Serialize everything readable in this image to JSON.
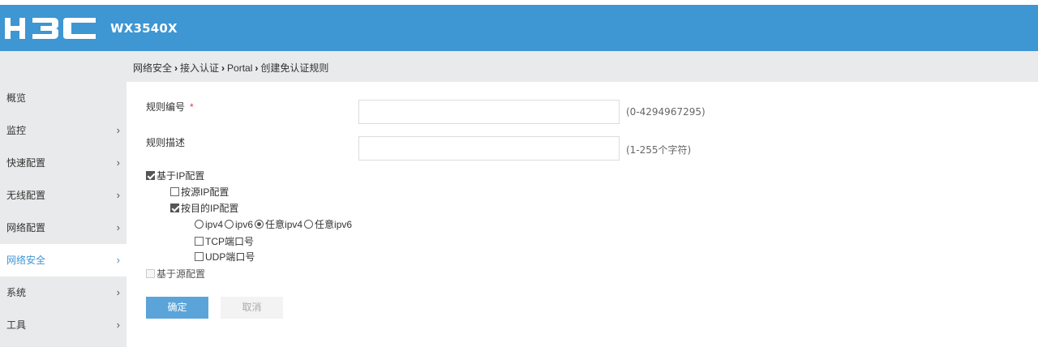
{
  "header": {
    "model": "WX3540X",
    "logo_text": "H3C"
  },
  "breadcrumb": [
    "网络安全",
    "接入认证",
    "Portal",
    "创建免认证规则"
  ],
  "sidebar": {
    "items": [
      {
        "label": "概览",
        "chevron": ""
      },
      {
        "label": "监控",
        "chevron": "›"
      },
      {
        "label": "快速配置",
        "chevron": "›"
      },
      {
        "label": "无线配置",
        "chevron": "›"
      },
      {
        "label": "网络配置",
        "chevron": "›"
      },
      {
        "label": "网络安全",
        "chevron": "›"
      },
      {
        "label": "系统",
        "chevron": "›"
      },
      {
        "label": "工具",
        "chevron": "›"
      }
    ],
    "active": "网络安全"
  },
  "form": {
    "rule_id": {
      "label": "规则编号",
      "required_mark": "*",
      "value": "",
      "hint": "(0-4294967295)"
    },
    "rule_desc": {
      "label": "规则描述",
      "value": "",
      "hint": "(1-255个字符)"
    },
    "ip_config": {
      "label": "基于IP配置",
      "checked": true
    },
    "src_ip": {
      "label": "按源IP配置",
      "checked": false
    },
    "dst_ip": {
      "label": "按目的IP配置",
      "checked": true
    },
    "ip_type": {
      "options": [
        "ipv4",
        "ipv6",
        "任意ipv4",
        "任意ipv6"
      ],
      "selected": "任意ipv4"
    },
    "tcp_port": {
      "label": "TCP端口号",
      "checked": false
    },
    "udp_port": {
      "label": "UDP端口号",
      "checked": false
    },
    "src_config": {
      "label": "基于源配置",
      "checked": false,
      "disabled": true
    }
  },
  "buttons": {
    "ok": "确定",
    "cancel": "取消"
  },
  "colors": {
    "brand_blue": "#3e96d3",
    "sidebar_bg": "#e9eaeb",
    "required": "#e03b3b"
  }
}
